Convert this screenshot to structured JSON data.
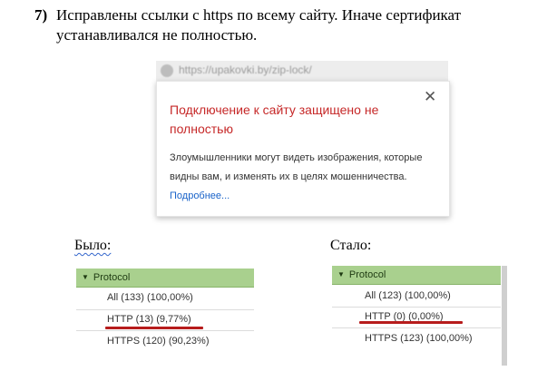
{
  "document": {
    "item_number": "7)",
    "text": "Исправлены ссылки с https по всему сайту. Иначе сертификат устанавливался не полностью."
  },
  "browser": {
    "url": "https://upakovki.by/zip-lock/",
    "popup": {
      "close_glyph": "✕",
      "title": "Подключение к сайту защищено не полностью",
      "body": "Злоумышленники могут видеть изображения, которые видны вам, и изменять их в целях мошенничества.",
      "link": "Подробнее..."
    }
  },
  "before": {
    "label": "Было:",
    "header": "Protocol",
    "rows": [
      "All (133) (100,00%)",
      "HTTP (13) (9,77%)",
      "HTTPS (120) (90,23%)"
    ]
  },
  "after": {
    "label": "Стало:",
    "header": "Protocol",
    "rows": [
      "All (123) (100,00%)",
      "HTTP (0) (0,00%)",
      "HTTPS (123) (100,00%)"
    ]
  },
  "colors": {
    "header_green": "#a9d08e",
    "warning_red": "#c62828",
    "underline_red": "#b71c1c",
    "link_blue": "#1a63c9"
  }
}
